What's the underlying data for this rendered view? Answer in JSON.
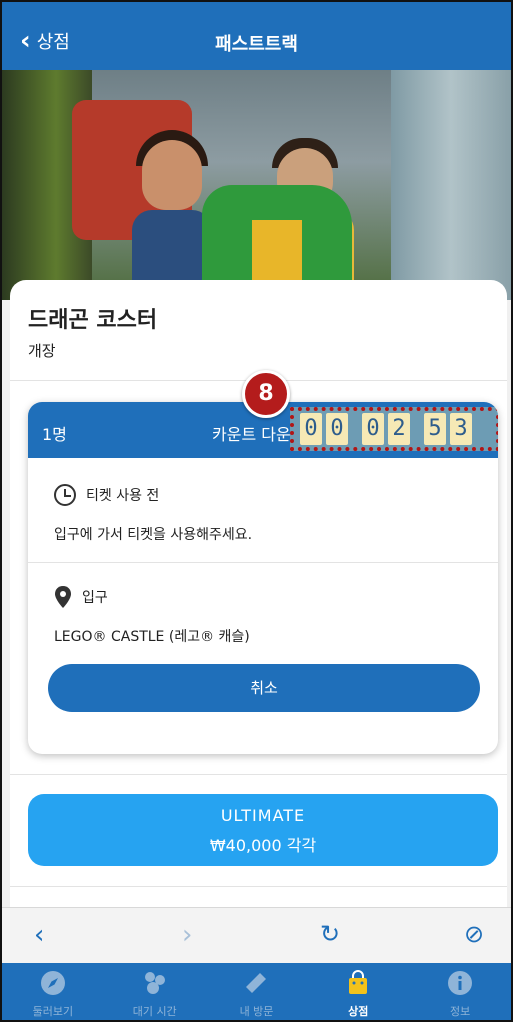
{
  "header": {
    "back_label": "상점",
    "title": "패스트트랙"
  },
  "ride": {
    "name": "드래곤 코스터",
    "status": "개장"
  },
  "ticket": {
    "count": "1명",
    "countdown_label": "카운트 다운",
    "countdown_digits": [
      "0",
      "0",
      "0",
      "2",
      "5",
      "3"
    ],
    "status": "티켓 사용 전",
    "instruction": "입구에 가서 티켓을 사용해주세요.",
    "location_label": "입구",
    "location_name": "LEGO® CASTLE (레고® 캐슬)",
    "cancel_label": "취소"
  },
  "offer": {
    "name": "ULTIMATE",
    "price": "₩40,000 각각"
  },
  "badge": "8",
  "tabs": [
    {
      "label": "둘러보기",
      "icon": "compass-icon"
    },
    {
      "label": "대기 시간",
      "icon": "people-icon"
    },
    {
      "label": "내 방문",
      "icon": "ticket-icon"
    },
    {
      "label": "상점",
      "icon": "shopping-bag-icon"
    },
    {
      "label": "정보",
      "icon": "info-icon"
    }
  ],
  "colors": {
    "primary": "#1f6fba",
    "accent": "#26a3f1",
    "highlight": "#b11616"
  }
}
